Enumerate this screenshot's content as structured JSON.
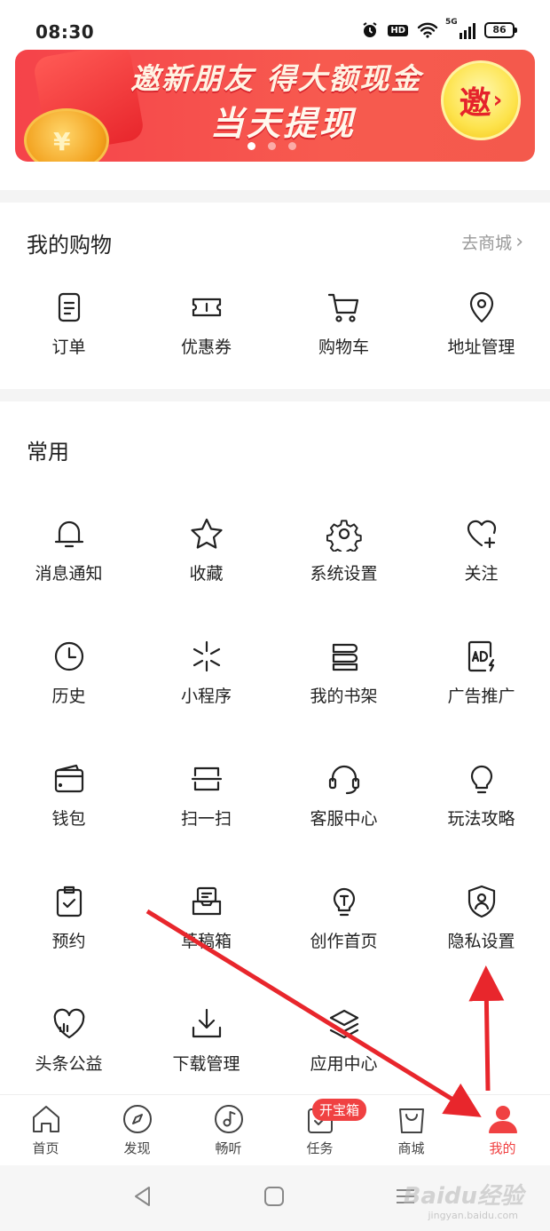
{
  "status_bar": {
    "time": "08:30",
    "hd": "HD",
    "network": "5G",
    "battery": "86"
  },
  "banner": {
    "line1": "邀新朋友 得大额现金",
    "line2": "当天提现",
    "cta": "邀",
    "cta_arrow": "›",
    "coin_symbol": "¥"
  },
  "shopping": {
    "title": "我的购物",
    "link": "去商城",
    "link_chevron": "›",
    "items": [
      {
        "label": "订单",
        "icon": "order-icon"
      },
      {
        "label": "优惠券",
        "icon": "coupon-icon"
      },
      {
        "label": "购物车",
        "icon": "cart-icon"
      },
      {
        "label": "地址管理",
        "icon": "location-icon"
      }
    ]
  },
  "common": {
    "title": "常用",
    "items": [
      {
        "label": "消息通知",
        "icon": "bell-icon"
      },
      {
        "label": "收藏",
        "icon": "star-icon"
      },
      {
        "label": "系统设置",
        "icon": "gear-icon"
      },
      {
        "label": "关注",
        "icon": "heart-plus-icon"
      },
      {
        "label": "历史",
        "icon": "clock-icon"
      },
      {
        "label": "小程序",
        "icon": "mini-program-icon"
      },
      {
        "label": "我的书架",
        "icon": "bookshelf-icon"
      },
      {
        "label": "广告推广",
        "icon": "ad-icon"
      },
      {
        "label": "钱包",
        "icon": "wallet-icon"
      },
      {
        "label": "扫一扫",
        "icon": "scan-icon"
      },
      {
        "label": "客服中心",
        "icon": "headset-icon"
      },
      {
        "label": "玩法攻略",
        "icon": "bulb-icon"
      },
      {
        "label": "预约",
        "icon": "clipboard-check-icon"
      },
      {
        "label": "草稿箱",
        "icon": "drafts-icon"
      },
      {
        "label": "创作首页",
        "icon": "creator-bulb-icon"
      },
      {
        "label": "隐私设置",
        "icon": "shield-user-icon"
      },
      {
        "label": "头条公益",
        "icon": "charity-heart-icon"
      },
      {
        "label": "下载管理",
        "icon": "download-icon"
      },
      {
        "label": "应用中心",
        "icon": "layers-icon"
      }
    ]
  },
  "bottom_nav": {
    "items": [
      {
        "label": "首页",
        "icon": "home-icon"
      },
      {
        "label": "发现",
        "icon": "compass-icon"
      },
      {
        "label": "畅听",
        "icon": "music-icon"
      },
      {
        "label": "任务",
        "icon": "task-icon"
      },
      {
        "label": "商城",
        "icon": "shopping-bag-icon"
      },
      {
        "label": "我的",
        "icon": "profile-icon"
      }
    ],
    "active": "我的",
    "task_badge": "开宝箱"
  },
  "watermark": {
    "text": "Baidu经验",
    "sub": "jingyan.baidu.com"
  },
  "colors": {
    "accent": "#f04142",
    "banner": "#f5434a",
    "annotation_arrow": "#e8262c"
  }
}
